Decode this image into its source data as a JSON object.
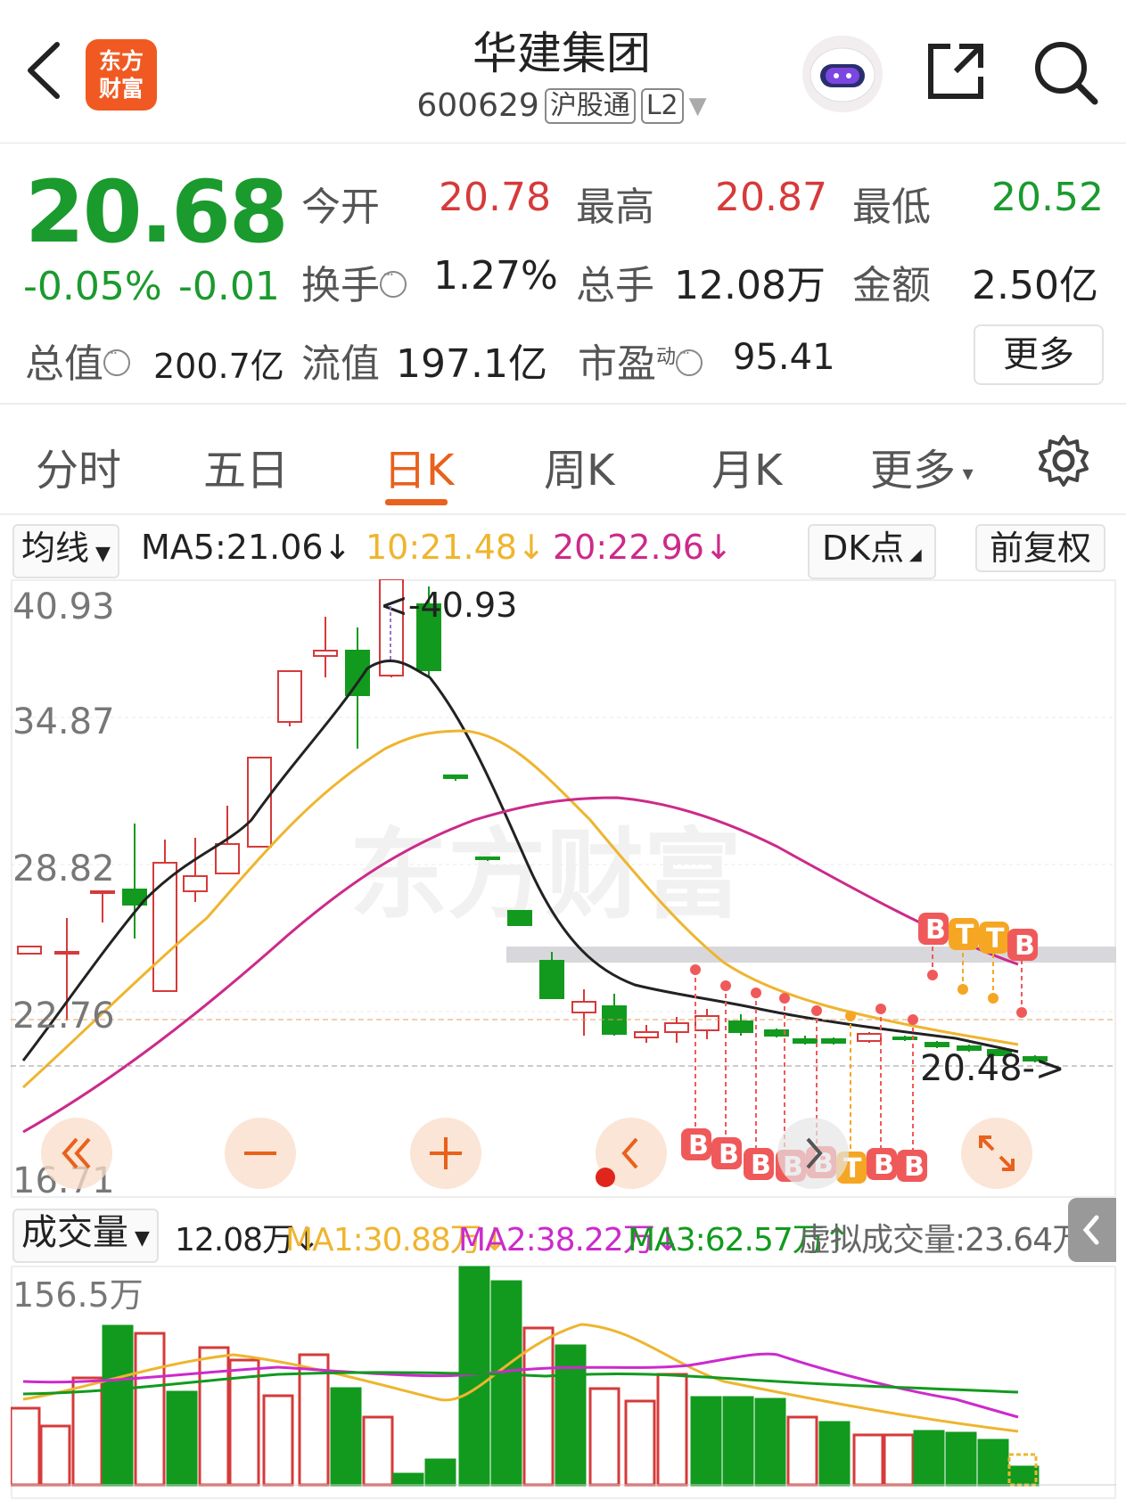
{
  "header": {
    "logo_line1": "东方",
    "logo_line2": "财富",
    "stock_name": "华建集团",
    "stock_code": "600629",
    "tag_connect": "沪股通",
    "tag_level": "L2"
  },
  "quote": {
    "price": "20.68",
    "change_pct": "-0.05%",
    "change_amt": "-0.01",
    "open_label": "今开",
    "open": "20.78",
    "high_label": "最高",
    "high": "20.87",
    "low_label": "最低",
    "low": "20.52",
    "turnover_label": "换手",
    "turnover": "1.27%",
    "volume_label": "总手",
    "volume": "12.08万",
    "amount_label": "金额",
    "amount": "2.50亿",
    "mktcap_label": "总值",
    "mktcap": "200.7亿",
    "float_label": "流值",
    "float_cap": "197.1亿",
    "pe_label": "市盈",
    "pe_sup": "动",
    "pe": "95.41",
    "more_label": "更多"
  },
  "tabs": [
    "分时",
    "五日",
    "日K",
    "周K",
    "月K",
    "更多"
  ],
  "indicators": {
    "ma_select": "均线",
    "ma5": "MA5:21.06↓",
    "ma10": "10:21.48↓",
    "ma20": "20:22.96↓",
    "dk_label": "DK点",
    "adjust_label": "前复权"
  },
  "kline": {
    "y_ticks": [
      "40.93",
      "34.87",
      "28.82",
      "22.76",
      "16.71"
    ],
    "max_marker": "<-40.93",
    "last_marker": "20.48->",
    "watermark": "东方财富",
    "colors": {
      "up": "#d63a3a",
      "down": "#129a1e",
      "ma5": "#222222",
      "ma10": "#eeb52f",
      "ma20": "#cc2a8a"
    },
    "signals": [
      "B",
      "T",
      "T",
      "B",
      "B",
      "B",
      "B",
      "B",
      "B",
      "T",
      "B",
      "B"
    ]
  },
  "volume": {
    "select": "成交量",
    "vol": "12.08万↓",
    "ma1": "MA1:30.88万↓",
    "ma2": "MA2:38.22万↓",
    "ma3": "MA3:62.57万↑",
    "virtual": "虚拟成交量:23.64万",
    "top_tick": "156.5万"
  }
}
